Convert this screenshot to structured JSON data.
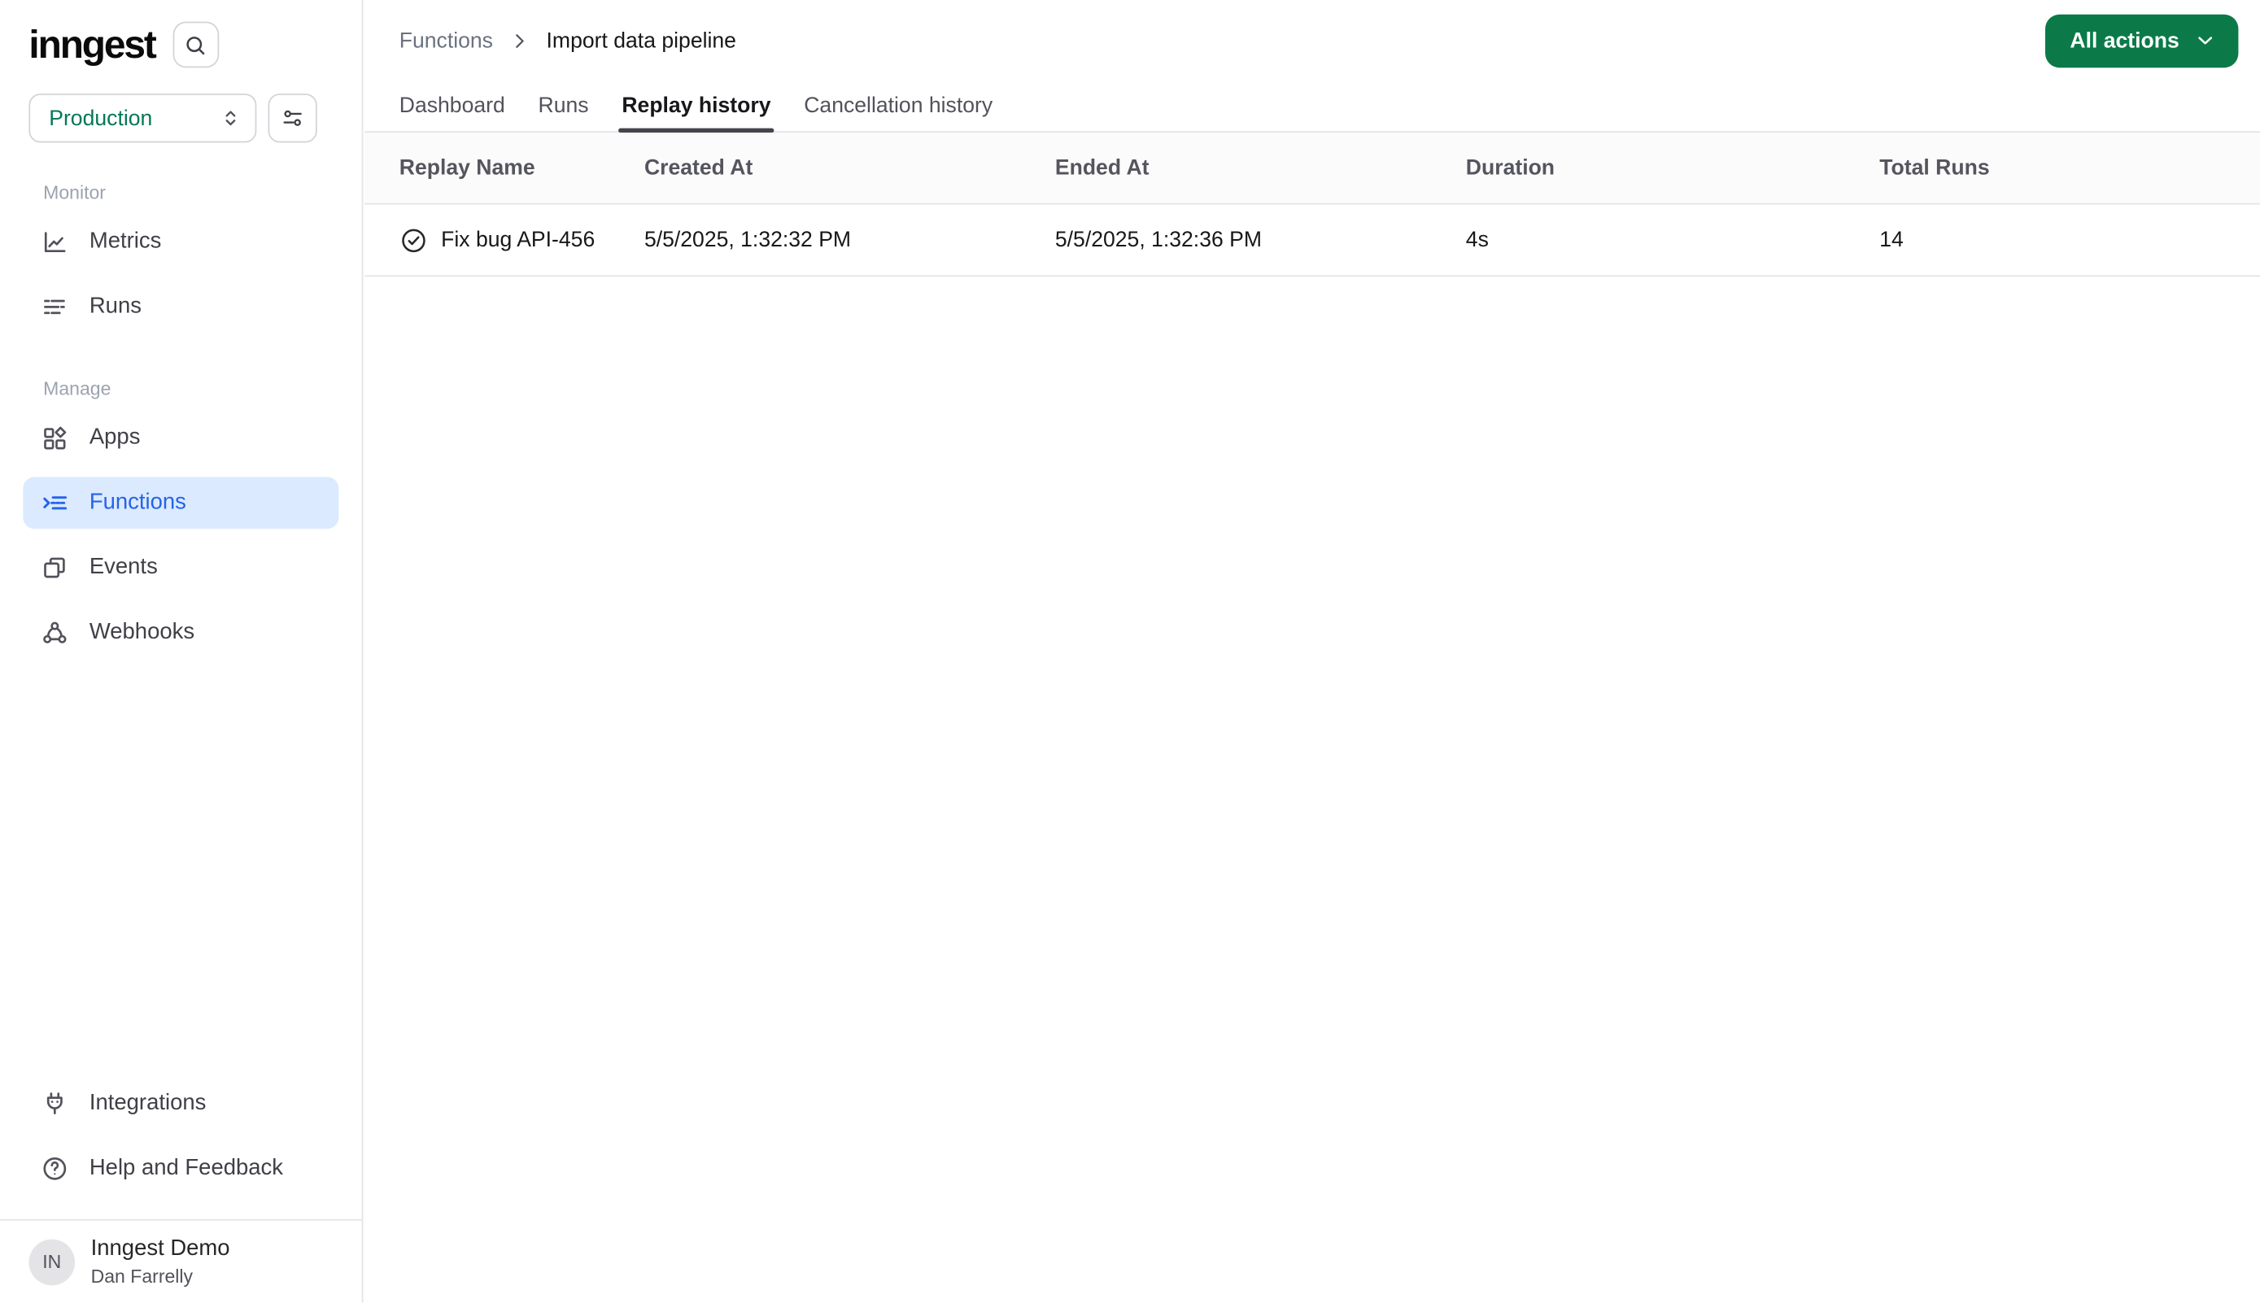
{
  "colors": {
    "accent_green": "#0b7a48",
    "env_green": "#047857",
    "active_blue": "#2563eb",
    "active_blue_bg": "#dbeafe",
    "border": "#e4e4e7"
  },
  "sidebar": {
    "logo": "inngest",
    "search_icon": "search-icon",
    "environment": {
      "value": "Production",
      "selector_icon": "chevron-up-down-icon",
      "filter_icon": "sliders-icon"
    },
    "sections": [
      {
        "label": "Monitor",
        "items": [
          {
            "label": "Metrics",
            "icon": "chart-line-icon",
            "active": false
          },
          {
            "label": "Runs",
            "icon": "dashed-list-icon",
            "active": false
          }
        ]
      },
      {
        "label": "Manage",
        "items": [
          {
            "label": "Apps",
            "icon": "apps-grid-icon",
            "active": false
          },
          {
            "label": "Functions",
            "icon": "function-list-icon",
            "active": true
          },
          {
            "label": "Events",
            "icon": "overlapping-squares-icon",
            "active": false
          },
          {
            "label": "Webhooks",
            "icon": "webhook-icon",
            "active": false
          }
        ]
      }
    ],
    "footer_items": [
      {
        "label": "Integrations",
        "icon": "plug-icon"
      },
      {
        "label": "Help and Feedback",
        "icon": "help-circle-icon"
      }
    ],
    "user": {
      "initials": "IN",
      "org_name": "Inngest Demo",
      "user_name": "Dan Farrelly"
    }
  },
  "header": {
    "breadcrumb": {
      "parent": "Functions",
      "separator_icon": "chevron-right-icon",
      "current": "Import data pipeline"
    },
    "action_button": {
      "label": "All actions",
      "icon": "chevron-down-icon"
    }
  },
  "tabs": [
    {
      "label": "Dashboard",
      "active": false
    },
    {
      "label": "Runs",
      "active": false
    },
    {
      "label": "Replay history",
      "active": true
    },
    {
      "label": "Cancellation history",
      "active": false
    }
  ],
  "replay_table": {
    "columns": [
      "Replay Name",
      "Created At",
      "Ended At",
      "Duration",
      "Total Runs"
    ],
    "rows": [
      {
        "status_icon": "check-circle-icon",
        "name": "Fix bug API-456",
        "created_at": "5/5/2025, 1:32:32 PM",
        "ended_at": "5/5/2025, 1:32:36 PM",
        "duration": "4s",
        "total_runs": "14"
      }
    ]
  }
}
